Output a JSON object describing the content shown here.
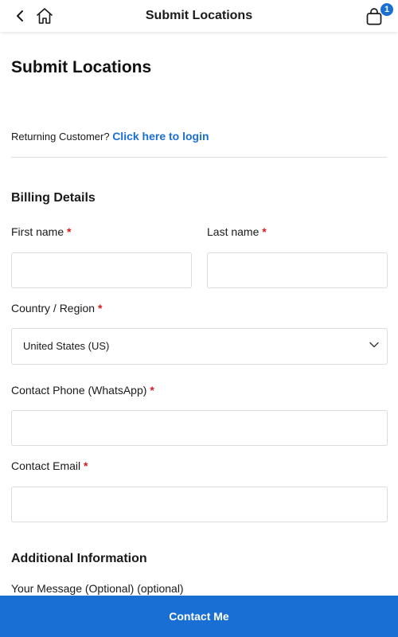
{
  "header": {
    "title": "Submit Locations",
    "cart_count": "1"
  },
  "page": {
    "title": "Submit Locations",
    "returning_text": "Returning Customer?",
    "login_link": "Click here to login"
  },
  "billing": {
    "title": "Billing Details",
    "first_name_label": "First name",
    "last_name_label": "Last name",
    "country_label": "Country / Region",
    "country_value": "United States (US)",
    "phone_label": "Contact Phone (WhatsApp)",
    "email_label": "Contact Email",
    "required_mark": "*",
    "first_name_value": "",
    "last_name_value": "",
    "phone_value": "",
    "email_value": ""
  },
  "additional": {
    "title": "Additional Information",
    "message_label": "Your Message (Optional) (optional)"
  },
  "footer": {
    "contact_button": "Contact Me"
  },
  "colors": {
    "accent": "#1a6fd4",
    "required": "#d9181e"
  },
  "icons": {
    "back": "chevron-left-icon",
    "home": "home-icon",
    "cart": "shopping-bag-icon",
    "select": "chevron-down-icon"
  }
}
